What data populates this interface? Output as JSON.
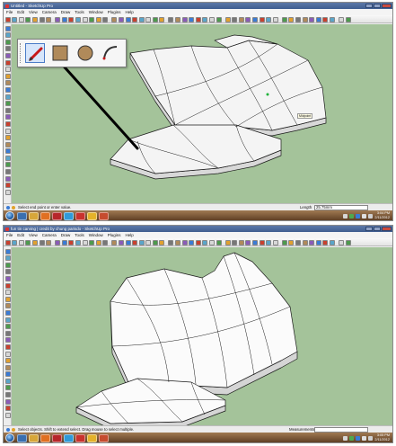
{
  "top_window": {
    "title": "Untitled - SketchUp Pro",
    "menu": [
      "File",
      "Edit",
      "View",
      "Camera",
      "Draw",
      "Tools",
      "Window",
      "Plugins",
      "Help"
    ],
    "inference_tooltip": "Midpoint",
    "status_hint": "Select end point or enter value.",
    "measurement_label": "Length",
    "measurement_value": "25.75mm",
    "floating_toolbar": [
      "line-pencil-icon",
      "rectangle-icon",
      "circle-icon",
      "arc-icon"
    ]
  },
  "top_taskbar": {
    "clock_time": "3:04 PM",
    "clock_date": "2/11/2012"
  },
  "bottom_window": {
    "title": "fun tin carving | credit by chung parisdo - SketchUp Pro",
    "menu": [
      "File",
      "Edit",
      "View",
      "Camera",
      "Draw",
      "Tools",
      "Window",
      "Plugins",
      "Help"
    ],
    "status_hint": "Select objects. Shift to extend select. Drag mouse to select multiple.",
    "measurement_label": "Measurements"
  },
  "bottom_taskbar": {
    "clock_time": "3:05 PM",
    "clock_date": "2/11/2012"
  },
  "colors": {
    "viewport": "#a4c39a",
    "titlebar": "#4a6898",
    "surface": "#f4f4f4",
    "edge": "#1a1a1a",
    "taskbar": "#6e4a2c"
  }
}
